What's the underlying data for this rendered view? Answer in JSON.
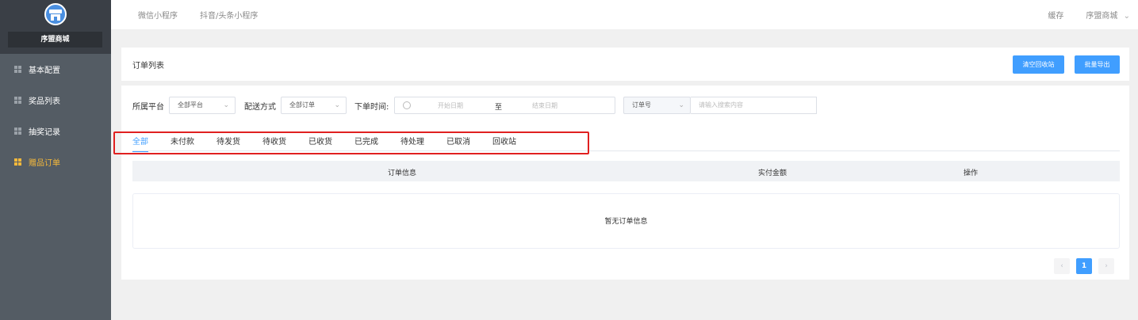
{
  "sidebar": {
    "store_name": "序盟商城",
    "items": [
      {
        "label": "基本配置"
      },
      {
        "label": "奖品列表"
      },
      {
        "label": "抽奖记录"
      },
      {
        "label": "赠品订单"
      }
    ]
  },
  "topbar": {
    "nav": [
      "微信小程序",
      "抖音/头条小程序"
    ],
    "cache": "缓存",
    "user": "序盟商城",
    "user_icon": "chevron-down-icon"
  },
  "header": {
    "title": "订单列表",
    "clear_recycle": "清空回收站",
    "batch_export": "批量导出"
  },
  "filters": {
    "platform_label": "所属平台",
    "platform_value": "全部平台",
    "delivery_label": "配送方式",
    "delivery_value": "全部订单",
    "time_label": "下单时间:",
    "start_placeholder": "开始日期",
    "range_sep": "至",
    "end_placeholder": "结束日期",
    "search_field": "订单号",
    "search_placeholder": "请输入搜索内容"
  },
  "tabs": [
    "全部",
    "未付款",
    "待发货",
    "待收货",
    "已收货",
    "已完成",
    "待处理",
    "已取消",
    "回收站"
  ],
  "table": {
    "columns": [
      "订单信息",
      "实付金额",
      "操作"
    ],
    "empty": "暂无订单信息"
  },
  "pagination": {
    "current": "1",
    "prev": "‹",
    "next": "›"
  },
  "colors": {
    "accent": "#409eff",
    "sidebar": "#545c64",
    "active_menu": "#f6b93b",
    "highlight": "#e02020"
  }
}
